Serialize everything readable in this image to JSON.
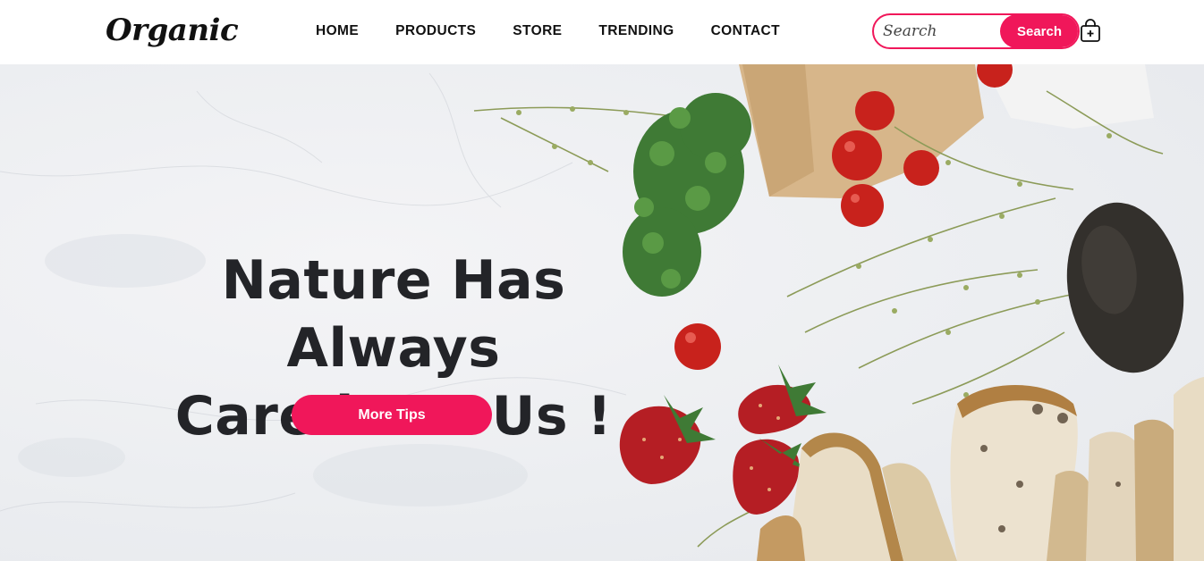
{
  "brand": {
    "logo_text": "Organic"
  },
  "nav": {
    "items": [
      {
        "label": "HOME"
      },
      {
        "label": "PRODUCTS"
      },
      {
        "label": "STORE"
      },
      {
        "label": "TRENDING"
      },
      {
        "label": "CONTACT"
      }
    ]
  },
  "search": {
    "placeholder": "Search",
    "button_label": "Search"
  },
  "cart": {
    "icon": "shopping-bag-icon"
  },
  "hero": {
    "title_line1": "Nature Has Always",
    "title_line2": "Cared For Us !",
    "cta_label": "More Tips",
    "image": "fresh-produce-on-marble-photo"
  },
  "colors": {
    "accent": "#f0175a",
    "text_dark": "#232428",
    "background": "#ffffff",
    "marble": "#eceef1"
  }
}
